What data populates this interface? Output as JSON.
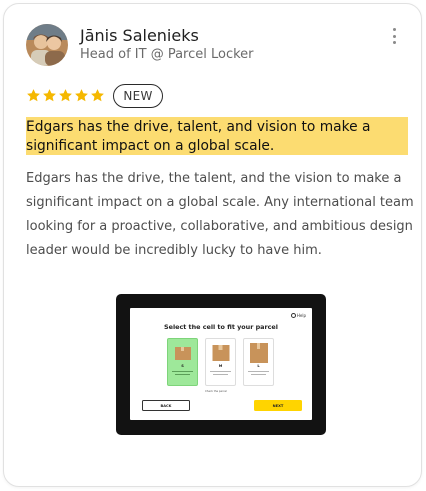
{
  "reviewer": {
    "name": "Jānis Salenieks",
    "role": "Head of IT @ Parcel Locker"
  },
  "menu_icon": "more-vertical-icon",
  "rating": {
    "value": 5,
    "max": 5,
    "color": "#f5b800"
  },
  "badge": "NEW",
  "highlight_color": "#fcdc71",
  "headline": "Edgars has the drive, talent, and vision to make a significant impact on a global scale.",
  "body": "Edgars has the drive, the talent, and the vision to make a significant impact on a global scale. Any international team looking for a proactive, collaborative, and ambitious design leader would be incredibly lucky to have him.",
  "tablet_screen": {
    "help": "Help",
    "title": "Select the cell to fit your parcel",
    "cells": [
      {
        "label": "S",
        "selected": true
      },
      {
        "label": "M",
        "selected": false
      },
      {
        "label": "L",
        "selected": false
      }
    ],
    "measure_note": "Check the parcel",
    "back_label": "BACK",
    "next_label": "NEXT",
    "accent": "#ffd400",
    "selected_color": "#9ee89a"
  }
}
